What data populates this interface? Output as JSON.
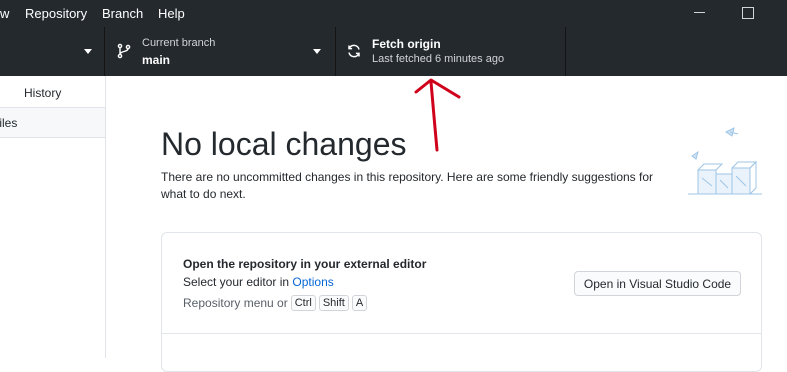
{
  "menu": {
    "items": [
      "w",
      "Repository",
      "Branch",
      "Help"
    ]
  },
  "toolbar": {
    "branch": {
      "title": "Current branch",
      "value": "main"
    },
    "fetch": {
      "title": "Fetch origin",
      "subtitle": "Last fetched 6 minutes ago"
    }
  },
  "sidebar": {
    "history_tab": "History",
    "files_tab": "files"
  },
  "main": {
    "title": "No local changes",
    "description": "There are no uncommitted changes in this repository. Here are some friendly suggestions for what to do next.",
    "card": {
      "title": "Open the repository in your external editor",
      "line_prefix": "Select your editor in ",
      "line_link": "Options",
      "hint_prefix": "Repository menu or",
      "keys": [
        "Ctrl",
        "Shift",
        "A"
      ],
      "button_label": "Open in Visual Studio Code"
    }
  },
  "colors": {
    "toolbar_bg": "#24292e",
    "link": "#0366d6",
    "annotation": "#d0021b",
    "illustration": "#9ec5e6"
  },
  "icons": {
    "branch": "git-branch-icon",
    "fetch": "sync-icon",
    "illustration": "boxes-illustration-icon"
  }
}
